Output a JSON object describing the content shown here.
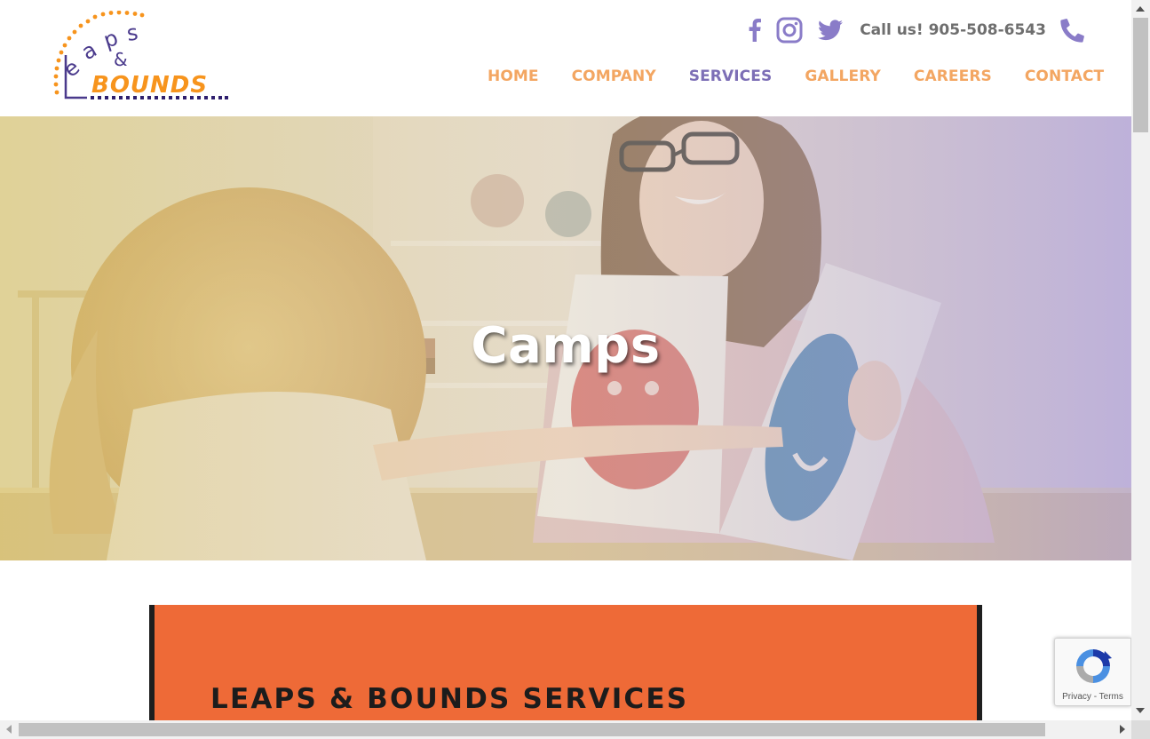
{
  "brand": {
    "logo_top": "Leaps",
    "logo_amp": "&",
    "logo_bottom": "BOUNDS",
    "colors": {
      "orange": "#f7941d",
      "purple": "#4a3a8c",
      "nav_orange": "#f3a662",
      "nav_active": "#7d6fb6",
      "icon_purple": "#8a7cc8"
    }
  },
  "topbar": {
    "icons": [
      "facebook-icon",
      "instagram-icon",
      "twitter-icon",
      "phone-icon"
    ],
    "call_text": "Call us! 905-508-6543"
  },
  "nav": {
    "items": [
      {
        "label": "HOME",
        "active": false
      },
      {
        "label": "COMPANY",
        "active": false
      },
      {
        "label": "SERVICES",
        "active": true
      },
      {
        "label": "GALLERY",
        "active": false
      },
      {
        "label": "CAREERS",
        "active": false
      },
      {
        "label": "CONTACT",
        "active": false
      }
    ]
  },
  "hero": {
    "title": "Camps"
  },
  "content": {
    "banner_text": "LEAPS & BOUNDS SERVICES",
    "banner_color": "#ee6a37"
  },
  "recaptcha": {
    "links": "Privacy - Terms"
  }
}
